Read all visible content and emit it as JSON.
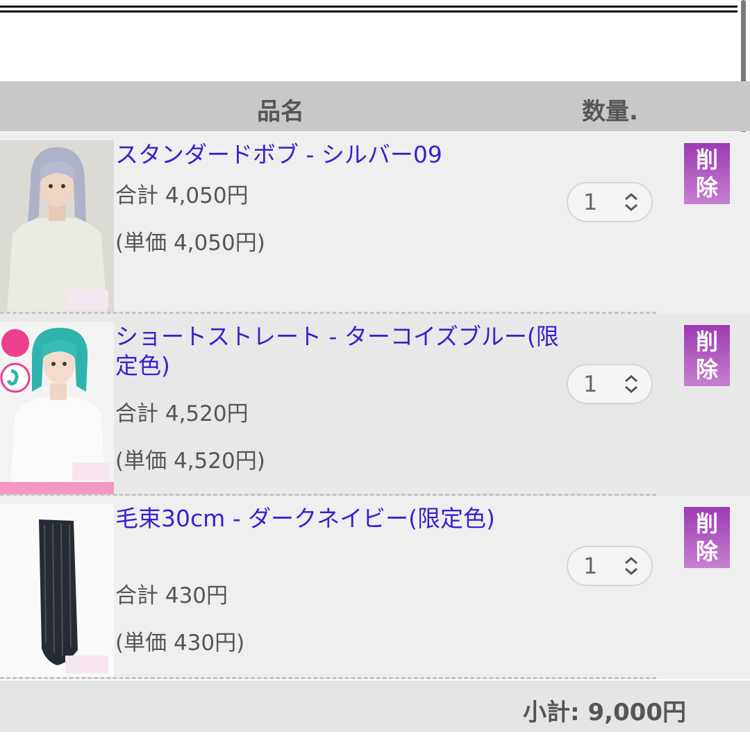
{
  "header": {
    "col_name": "品名",
    "col_qty": "数量."
  },
  "items": [
    {
      "name": "スタンダードボブ - シルバー09",
      "total": "合計 4,050円",
      "unit": "(単価 4,050円)",
      "quantity": "1",
      "delete_label": "削除",
      "image": "silver-bob-wig-photo"
    },
    {
      "name": "ショートストレート - ターコイズブルー(限定色)",
      "total": "合計 4,520円",
      "unit": "(単価 4,520円)",
      "quantity": "1",
      "delete_label": "削除",
      "image": "turquoise-short-wig-photo"
    },
    {
      "name": "毛束30cm - ダークネイビー(限定色)",
      "total": "合計 430円",
      "unit": "(単価 430円)",
      "quantity": "1",
      "delete_label": "削除",
      "image": "dark-navy-hair-extension-photo"
    }
  ],
  "subtotal": "小計: 9,000円",
  "colors": {
    "link": "#3a1fcf",
    "delete_button": "#a548b8",
    "header_bg": "#c8c8c8"
  }
}
